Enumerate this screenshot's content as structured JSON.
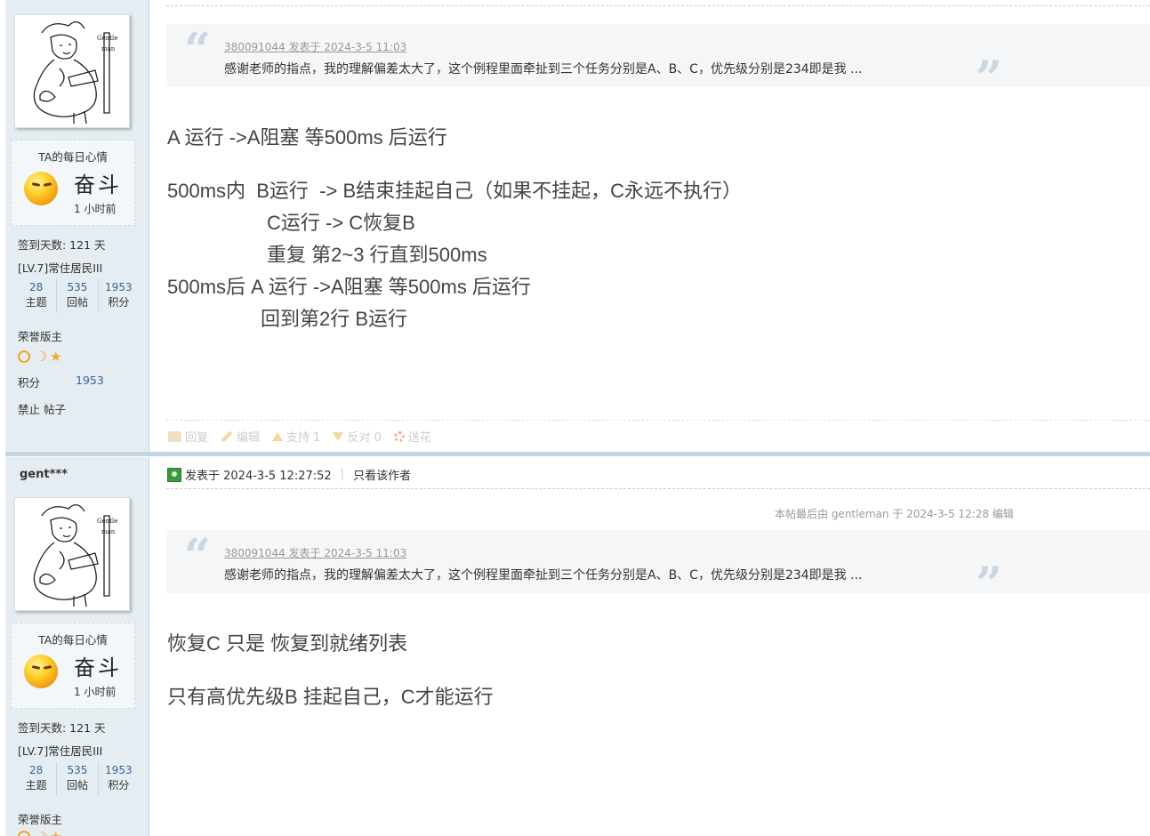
{
  "post1": {
    "quote": {
      "author_line": "380091044 发表于 2024-3-5 11:03",
      "text": "感谢老师的指点，我的理解偏差太大了，这个例程里面牵扯到三个任务分别是A、B、C，优先级分别是234即是我 ..."
    },
    "lines": [
      "A 运行 ->A阻塞 等500ms 后运行",
      "500ms内  B运行  -> B结束挂起自己（如果不挂起，C永远不执行）",
      "C运行 -> C恢复B",
      "重复 第2~3 行直到500ms",
      "500ms后 A 运行 ->A阻塞 等500ms 后运行",
      "回到第2行 B运行"
    ],
    "actions": {
      "reply": "回复",
      "edit": "编辑",
      "support": "支持 1",
      "oppose": "反对 0",
      "flower": "送花"
    }
  },
  "sidebar": {
    "username": "gent***",
    "mood_title": "TA的每日心情",
    "mood_word": "奋斗",
    "mood_time": "1 小时前",
    "signin": "签到天数: 121 天",
    "level": "[LV.7]常住居民III",
    "stats": [
      {
        "n": "28",
        "l": "主题"
      },
      {
        "n": "535",
        "l": "回帖"
      },
      {
        "n": "1953",
        "l": "积分"
      }
    ],
    "honor": "荣誉版主",
    "score_label": "积分",
    "score_value": "1953",
    "ban": "禁止 帖子"
  },
  "post2": {
    "meta": "发表于 2024-3-5 12:27:52",
    "only_author": "只看该作者",
    "edit_note": "本帖最后由 gentleman 于 2024-3-5 12:28 编辑",
    "quote": {
      "author_line": "380091044 发表于 2024-3-5 11:03",
      "text": "感谢老师的指点，我的理解偏差太大了，这个例程里面牵扯到三个任务分别是A、B、C，优先级分别是234即是我 ..."
    },
    "lines": [
      "恢复C 只是 恢复到就绪列表",
      "只有高优先级B 挂起自己，C才能运行"
    ]
  }
}
